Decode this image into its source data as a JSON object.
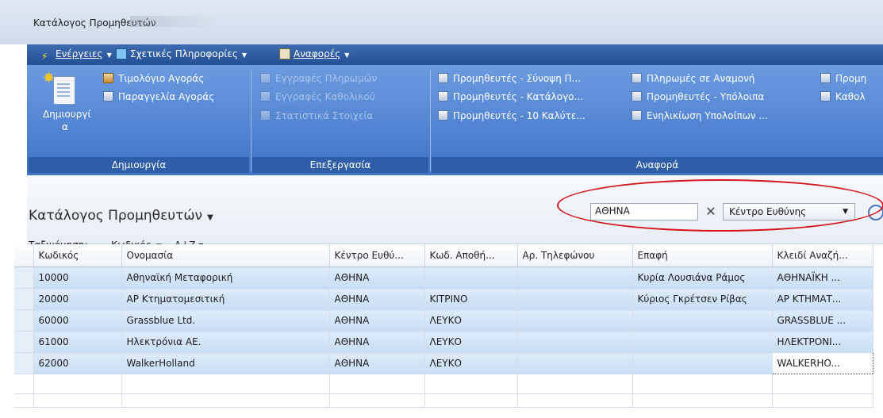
{
  "window": {
    "title": "Κατάλογος Προμηθευτών"
  },
  "menu": {
    "actions": "Ενέργειες",
    "related": "Σχετικές Πληροφορίες",
    "reports": "Αναφορές"
  },
  "ribbon": {
    "create_group": {
      "new_label": "Δημιουργί α",
      "invoice": "Τιμολόγιο Αγοράς",
      "order": "Παραγγελία Αγοράς",
      "label": "Δημιουργία"
    },
    "process_group": {
      "payment_entries": "Εγγραφές Πληρωμών",
      "ledger_entries": "Εγγραφές Καθολικού",
      "statistics": "Στατιστικά Στοιχεία",
      "label": "Επεξεργασία"
    },
    "report_group": {
      "summary": "Προμηθευτές - Σύνοψη Π...",
      "list": "Προμηθευτές - Κατάλογο...",
      "top10": "Προμηθευτές - 10 Καλύτε...",
      "pending": "Πληρωμές σε Αναμονή",
      "balance": "Προμηθευτές - Υπόλοιπα",
      "aging": "Ενηλικίωση Υπολοίπων ...",
      "more1": "Προμη",
      "more2": "Καθολ",
      "label": "Αναφορά"
    }
  },
  "page": {
    "title": "Κατάλογος Προμηθευτών",
    "sort_label": "Ταξινόμηση:",
    "sort_field": "Κωδικός"
  },
  "filter": {
    "value": "ΑΘΗΝΑ",
    "field": "Κέντρο Ευθύνης"
  },
  "table": {
    "headers": [
      "Κωδικός",
      "Ονομασία",
      "Κέντρο Ευθύ...",
      "Κωδ. Αποθή...",
      "Αρ. Τηλεφώνου",
      "Επαφή",
      "Κλειδί Αναζή..."
    ],
    "rows": [
      [
        "10000",
        "Αθηναϊκή Μεταφορική",
        "ΑΘΗΝΑ",
        "",
        "",
        "Κυρία Λουσιάνα Ράμος",
        "ΑΘΗΝΑΪΚΗ ..."
      ],
      [
        "20000",
        "ΑΡ Κτηματομεσιτική",
        "ΑΘΗΝΑ",
        "ΚΙΤΡΙΝΟ",
        "",
        "Κύριος Γκρέτσεν Ρίβας",
        "ΑΡ ΚΤΗΜΑΤ..."
      ],
      [
        "60000",
        "Grassblue Ltd.",
        "ΑΘΗΝΑ",
        "ΛΕΥΚΟ",
        "",
        "",
        "GRASSBLUE ..."
      ],
      [
        "61000",
        "Ηλεκτρόνια ΑΕ.",
        "ΑΘΗΝΑ",
        "ΛΕΥΚΟ",
        "",
        "",
        "ΗΛΕΚΤΡΟΝΙ..."
      ],
      [
        "62000",
        "WalkerHolland",
        "ΑΘΗΝΑ",
        "ΛΕΥΚΟ",
        "",
        "",
        "WALKERHO..."
      ]
    ]
  },
  "colors": {
    "accent": "#244f93",
    "ribbon": "#5586d6",
    "highlight": "#d4161b",
    "row": "#cfe3f7"
  }
}
